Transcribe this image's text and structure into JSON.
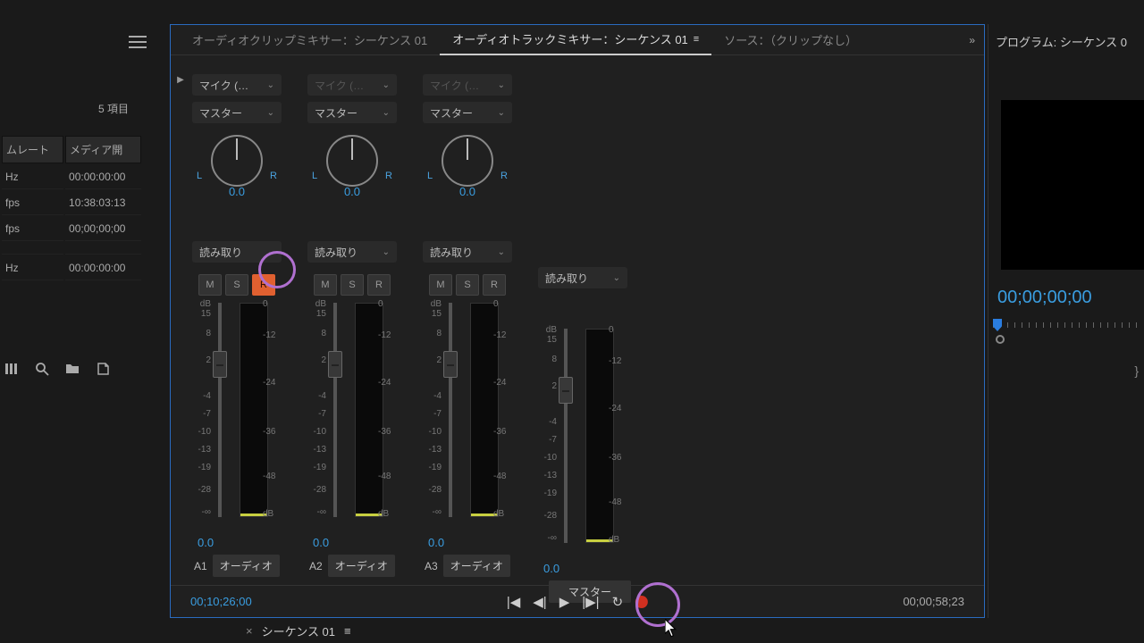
{
  "left": {
    "item_count": "5 項目",
    "columns": [
      "ムレート",
      "メディア開"
    ],
    "rows": [
      [
        "Hz",
        "00:00:00:00"
      ],
      [
        "fps",
        "10:38:03:13"
      ],
      [
        "fps",
        "00;00;00;00"
      ],
      [
        "",
        ""
      ],
      [
        "Hz",
        "00:00:00:00"
      ]
    ]
  },
  "tabs": {
    "clip_mixer": "オーディオクリップミキサー：シーケンス 01",
    "track_mixer": "オーディオトラックミキサー：シーケンス 01",
    "source": "ソース：（クリップなし）"
  },
  "dropdowns": {
    "mic": "マイク (…",
    "master": "マスター",
    "read": "読み取り"
  },
  "pan": {
    "l": "L",
    "r": "R",
    "val": "0.0"
  },
  "btns": {
    "m": "M",
    "s": "S",
    "r": "R"
  },
  "scale_left": {
    "db": "dB",
    "v15": "15",
    "v8": "8",
    "v2": "2",
    "vm4": "-4",
    "vm7": "-7",
    "vm10": "-10",
    "vm13": "-13",
    "vm19": "-19",
    "vm28": "-28",
    "vinf": "-∞"
  },
  "scale_right": {
    "v0": "0",
    "vm12": "-12",
    "vm24": "-24",
    "vm36": "-36",
    "vm48": "-48",
    "db": "dB"
  },
  "fader_val": "0.0",
  "tracks": [
    {
      "id": "A1",
      "name": "オーディオ"
    },
    {
      "id": "A2",
      "name": "オーディオ"
    },
    {
      "id": "A3",
      "name": "オーディオ"
    },
    {
      "id": "",
      "name": "マスター"
    }
  ],
  "transport": {
    "tc_left": "00;10;26;00",
    "tc_right": "00;00;58;23"
  },
  "right": {
    "tab": "プログラム: シーケンス 0",
    "tc": "00;00;00;00"
  },
  "sequence_tab": {
    "x": "×",
    "name": "シーケンス 01"
  }
}
